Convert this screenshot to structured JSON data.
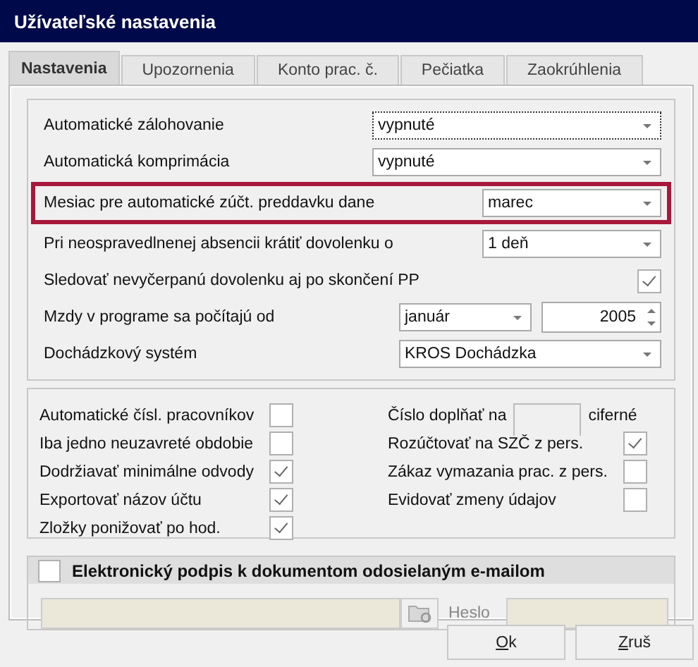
{
  "window": {
    "title": "Užívateľské nastavenia"
  },
  "tabs": [
    {
      "label": "Nastavenia",
      "selected": true
    },
    {
      "label": "Upozornenia",
      "selected": false
    },
    {
      "label": "Konto prac. č.",
      "selected": false
    },
    {
      "label": "Pečiatka",
      "selected": false
    },
    {
      "label": "Zaokrúhlenia",
      "selected": false
    }
  ],
  "settings": [
    {
      "kind": "select",
      "label": "Automatické zálohovanie",
      "value": "vypnuté",
      "highlighted": false,
      "focused": true
    },
    {
      "kind": "select",
      "label": "Automatická komprimácia",
      "value": "vypnuté",
      "highlighted": false,
      "focused": false
    },
    {
      "kind": "select_short",
      "label": "Mesiac pre automatické zúčt. preddavku dane",
      "value": "marec",
      "highlighted": true,
      "focused": false
    },
    {
      "kind": "select_short",
      "label": "Pri neospravedlnenej absencii krátiť dovolenku o",
      "value": "1 deň",
      "highlighted": false,
      "focused": false
    },
    {
      "kind": "checkbox",
      "label": "Sledovať nevyčerpanú dovolenku aj po skončení PP",
      "checked": true,
      "highlighted": false
    },
    {
      "kind": "month_year",
      "label": "Mzdy v programe sa počítajú od",
      "value": "január",
      "year": "2005",
      "highlighted": false
    },
    {
      "kind": "select_mid",
      "label": "Dochádzkový systém",
      "value": "KROS Dochádzka",
      "highlighted": false,
      "focused": false
    }
  ],
  "options_left": [
    {
      "label": "Automatické čísl. pracovníkov",
      "checked": false
    },
    {
      "label": "Iba jedno neuzavreté obdobie",
      "checked": false
    },
    {
      "label": "Dodržiavať minimálne odvody",
      "checked": true
    },
    {
      "label": "Exportovať názov účtu",
      "checked": true
    },
    {
      "label": "Zložky ponižovať po hod.",
      "checked": true
    }
  ],
  "options_right": [
    {
      "kind": "number",
      "label": "Číslo doplňať na",
      "suffix": "ciferné"
    },
    {
      "kind": "checkbox",
      "label": "Rozúčtovať na SZČ z pers.",
      "checked": true
    },
    {
      "kind": "checkbox",
      "label": "Zákaz vymazania prac. z pers.",
      "checked": false
    },
    {
      "kind": "checkbox",
      "label": "Evidovať zmeny údajov",
      "checked": false
    }
  ],
  "signature": {
    "title": "Elektronický podpis k dokumentom odosielaným e-mailom",
    "checked": false,
    "password_label": "Heslo"
  },
  "buttons": [
    "Ok",
    "Zruš"
  ]
}
